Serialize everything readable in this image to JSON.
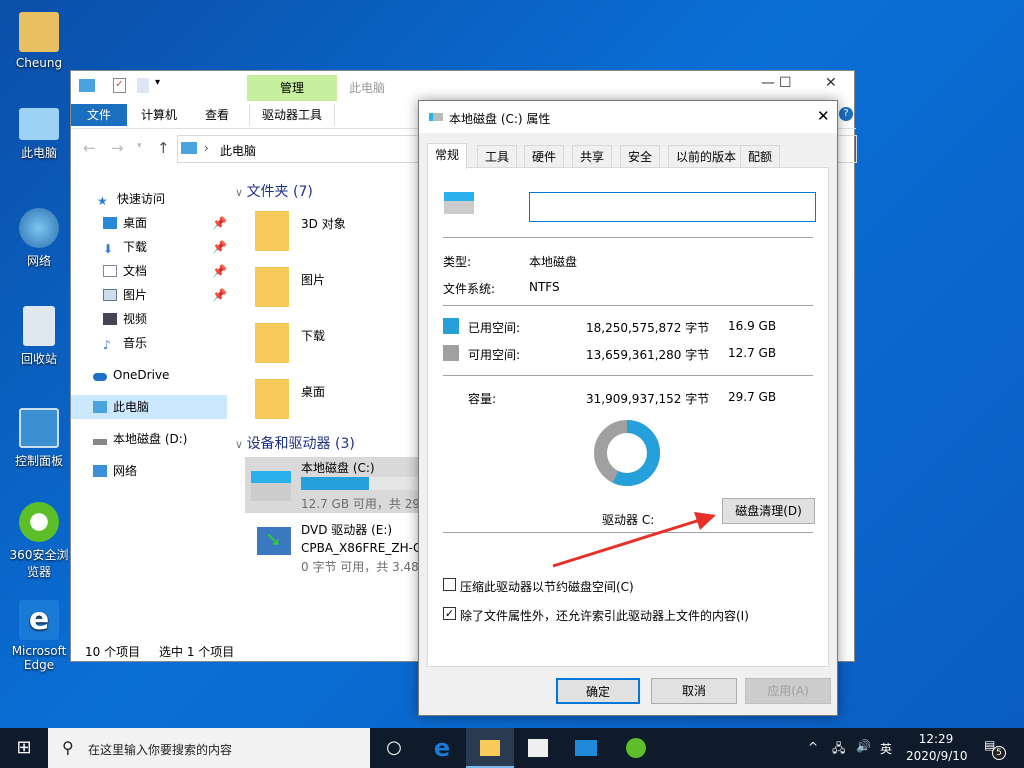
{
  "desktop": {
    "icons": [
      {
        "label": "Cheung"
      },
      {
        "label": "此电脑"
      },
      {
        "label": "网络"
      },
      {
        "label": "回收站"
      },
      {
        "label": "控制面板"
      },
      {
        "label": "360安全浏览器"
      },
      {
        "label": "Microsoft Edge"
      }
    ]
  },
  "explorer": {
    "title": "此电脑",
    "context_tab": "管理",
    "ribbon_tabs": [
      "文件",
      "计算机",
      "查看",
      "驱动器工具"
    ],
    "address": "此电脑",
    "nav": [
      {
        "label": "快速访问"
      },
      {
        "label": "桌面"
      },
      {
        "label": "下载"
      },
      {
        "label": "文档"
      },
      {
        "label": "图片"
      },
      {
        "label": "视频"
      },
      {
        "label": "音乐"
      },
      {
        "label": "OneDrive"
      },
      {
        "label": "此电脑"
      },
      {
        "label": "本地磁盘 (D:)"
      },
      {
        "label": "网络"
      }
    ],
    "folders_header": "文件夹 (7)",
    "folders": [
      "3D 对象",
      "图片",
      "下载",
      "桌面"
    ],
    "devices_header": "设备和驱动器 (3)",
    "drives": [
      {
        "name": "本地磁盘 (C:)",
        "info": "12.7 GB 可用，共 29.",
        "used_fraction": 0.57
      },
      {
        "name": "DVD 驱动器 (E:)",
        "label2": "CPBA_X86FRE_ZH-CN",
        "info": "0 字节 可用，共 3.48"
      }
    ],
    "status": {
      "count": "10 个项目",
      "selected": "选中 1 个项目"
    },
    "window_controls": {
      "minimize": "—",
      "maximize": "☐",
      "close": "✕"
    }
  },
  "dialog": {
    "title": "本地磁盘 (C:) 属性",
    "close": "✕",
    "tabs": [
      "常规",
      "工具",
      "硬件",
      "共享",
      "安全",
      "以前的版本",
      "配额"
    ],
    "name_value": "",
    "type_label": "类型:",
    "type_value": "本地磁盘",
    "fs_label": "文件系统:",
    "fs_value": "NTFS",
    "used_label": "已用空间:",
    "used_bytes": "18,250,575,872 字节",
    "used_gb": "16.9 GB",
    "free_label": "可用空间:",
    "free_bytes": "13,659,361,280 字节",
    "free_gb": "12.7 GB",
    "cap_label": "容量:",
    "cap_bytes": "31,909,937,152 字节",
    "cap_gb": "29.7 GB",
    "used_fraction": 0.57,
    "drive_label": "驱动器 C:",
    "cleanup_button": "磁盘清理(D)",
    "compress_label": "压缩此驱动器以节约磁盘空间(C)",
    "compress_checked": false,
    "index_label": "除了文件属性外，还允许索引此驱动器上文件的内容(I)",
    "index_checked": true,
    "ok": "确定",
    "cancel": "取消",
    "apply": "应用(A)",
    "colors": {
      "used": "#26a0da",
      "free": "#a0a0a0",
      "arrow": "#e8302a"
    }
  },
  "taskbar": {
    "search_placeholder": "在这里输入你要搜索的内容",
    "time": "12:29",
    "date": "2020/9/10",
    "ime": "英",
    "notifications": "5"
  }
}
